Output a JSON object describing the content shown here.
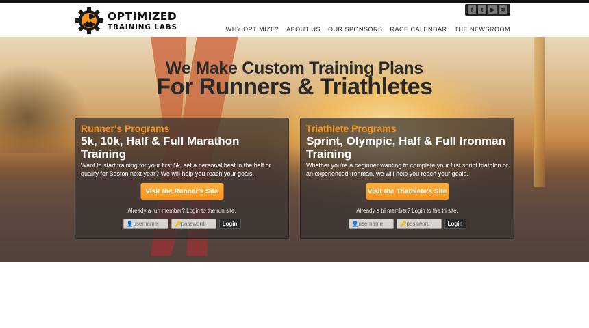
{
  "header": {
    "logo": {
      "line1": "OPTIMIZED",
      "line2": "TRAINING LABS"
    },
    "social": [
      {
        "icon": "facebook-icon",
        "glyph": "f"
      },
      {
        "icon": "twitter-icon",
        "glyph": "t"
      },
      {
        "icon": "youtube-icon",
        "glyph": "▶"
      },
      {
        "icon": "rss-icon",
        "glyph": "≋"
      }
    ],
    "nav": [
      "WHY OPTIMIZE?",
      "ABOUT US",
      "OUR SPONSORS",
      "RACE CALENDAR",
      "THE NEWSROOM"
    ]
  },
  "hero": {
    "headline1": "We Make Custom Training Plans",
    "headline2": "For Runners & Triathletes"
  },
  "panels": [
    {
      "kicker": "Runner's Programs",
      "title": "5k, 10k, Half & Full Marathon Training",
      "description": "Want to start training for your first 5k, set a personal best in the half or qualify for Boston next year? We will help you reach your goals.",
      "visit_pre": "Visit",
      "visit_em": "the",
      "visit_post": "Runner's Site",
      "member_text": "Already a run member? Login to the run site.",
      "username_placeholder": "username",
      "password_placeholder": "password",
      "login_label": "Login"
    },
    {
      "kicker": "Triathlete Programs",
      "title": "Sprint, Olympic, Half & Full Ironman Training",
      "description": "Whether you're a beginner wanting to complete your first sprint triathlon or an experienced Ironman, we will help you reach your goals.",
      "visit_pre": "Visit",
      "visit_em": "the",
      "visit_post": "Triathlete's Site",
      "member_text": "Already a tri member? Login to the tri site.",
      "username_placeholder": "username",
      "password_placeholder": "password",
      "login_label": "Login"
    }
  ],
  "colors": {
    "accent": "#f7941d",
    "text_dark": "#2a2a2a",
    "panel_bg": "#37322f"
  }
}
